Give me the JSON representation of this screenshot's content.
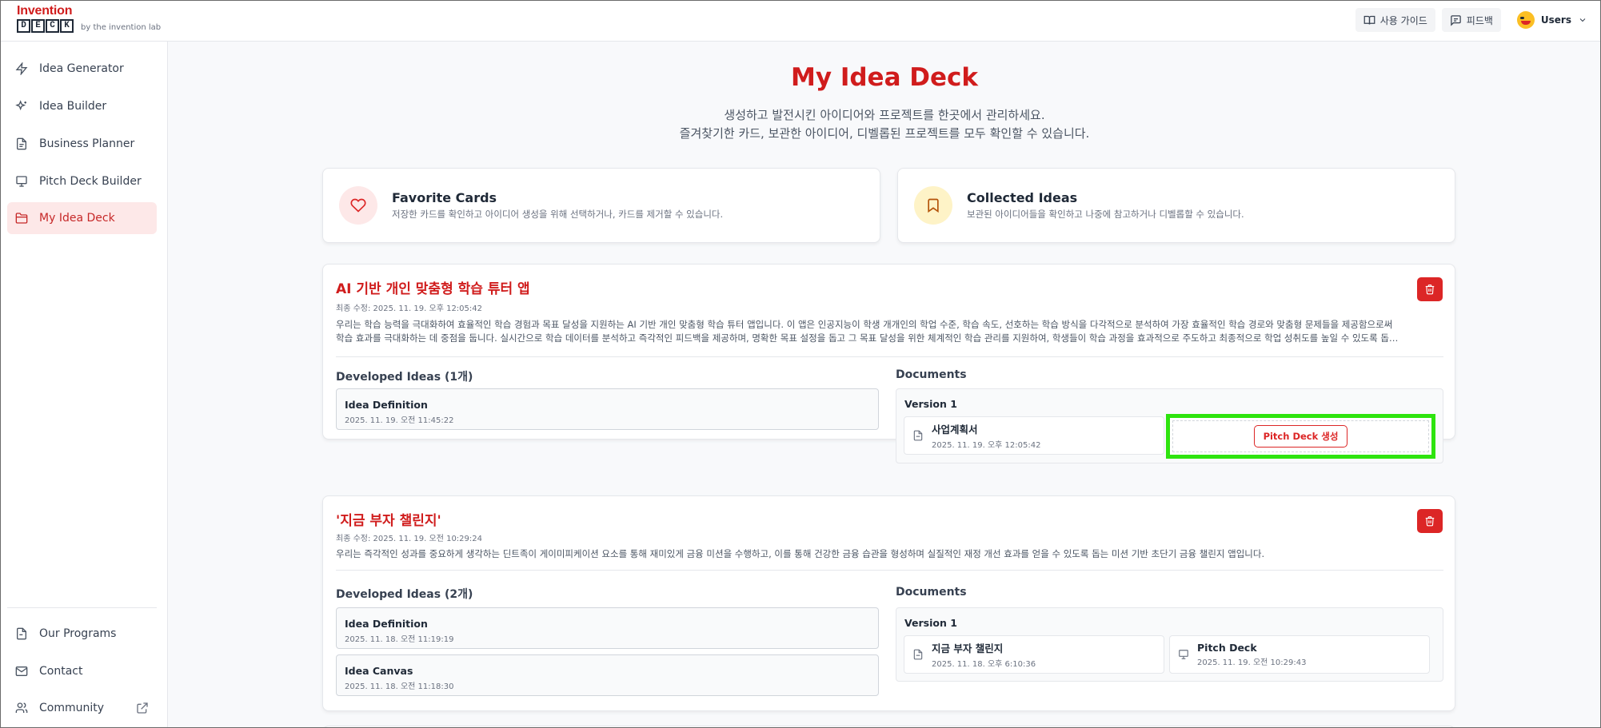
{
  "app": {
    "logo_top": "Invention",
    "logo_letters": [
      "D",
      "E",
      "C",
      "K"
    ],
    "logo_by": "by the invention lab",
    "brand_color": "#d01c1c"
  },
  "topbar": {
    "guide_label": "사용 가이드",
    "guide_icon": "book-open-icon",
    "feedback_label": "피드백",
    "feedback_icon": "message-square-icon",
    "user_label": "Users"
  },
  "sidebar": {
    "items": [
      {
        "label": "Idea Generator",
        "icon": "zap-icon"
      },
      {
        "label": "Idea Builder",
        "icon": "sparkles-icon"
      },
      {
        "label": "Business Planner",
        "icon": "file-text-icon"
      },
      {
        "label": "Pitch Deck Builder",
        "icon": "presentation-icon"
      },
      {
        "label": "My Idea Deck",
        "icon": "folder-icon",
        "active": true
      }
    ],
    "bottom_items": [
      {
        "label": "Our Programs",
        "icon": "file-icon"
      },
      {
        "label": "Contact",
        "icon": "mail-icon"
      },
      {
        "label": "Community",
        "icon": "users-icon",
        "external": true
      }
    ]
  },
  "page": {
    "title": "My Idea Deck",
    "subtitle_line1": "생성하고 발전시킨 아이디어와 프로젝트를 한곳에서 관리하세요.",
    "subtitle_line2": "즐겨찾기한 카드, 보관한 아이디어, 디벨롭된 프로젝트를 모두 확인할 수 있습니다."
  },
  "summary": {
    "favorites": {
      "title": "Favorite Cards",
      "desc": "저장한 카드를 확인하고 아이디어 생성을 위해 선택하거나, 카드를 제거할 수 있습니다.",
      "icon": "heart-icon"
    },
    "collected": {
      "title": "Collected Ideas",
      "desc": "보관된 아이디어들을 확인하고 나중에 참고하거나 디벨롭할 수 있습니다.",
      "icon": "bookmark-icon"
    }
  },
  "projects": [
    {
      "title": "AI 기반 개인 맞춤형 학습 튜터 앱",
      "modified": "최종 수정: 2025. 11. 19. 오후 12:05:42",
      "desc_line1": "우리는 학습 능력을 극대화하여 효율적인 학습 경험과 목표 달성을 지원하는 AI 기반 개인 맞춤형 학습 튜터 앱입니다. 이 앱은 인공지능이 학생 개개인의 학업 수준, 학습 속도, 선호하는 학습 방식을 다각적으로 분석하여 가장 효율적인 학습 경로와 맞춤형 문제들을 제공함으로써",
      "desc_line2": "학습 효과를 극대화하는 데 중점을 둡니다. 실시간으로 학습 데이터를 분석하고 즉각적인 피드백을 제공하며, 명확한 목표 설정을 돕고 그 목표 달성을 위한 체계적인 학습 관리를 지원하여, 학생들이 학습 과정을 효과적으로 주도하고 최종적으로 학업 성취도를 높일 수 있도록 돕…",
      "developed_label": "Developed Ideas (1개)",
      "ideas": [
        {
          "name": "Idea Definition",
          "date": "2025. 11. 19. 오전 11:45:22"
        }
      ],
      "documents_label": "Documents",
      "version_label": "Version 1",
      "docs": [
        {
          "name": "사업계획서",
          "date": "2025. 11. 19. 오후 12:05:42",
          "icon": "file-text-icon"
        }
      ],
      "pitch_button": "Pitch Deck 생성"
    },
    {
      "title": "'지금 부자 챌린지'",
      "modified": "최종 수정: 2025. 11. 19. 오전 10:29:24",
      "desc_line1": "우리는 즉각적인 성과를 중요하게 생각하는 딘트족이 게이미피케이션 요소를 통해 재미있게 금융 미션을 수행하고, 이를 통해 건강한 금융 습관을 형성하며 실질적인 재정 개선 효과를 얻을 수 있도록 돕는 미션 기반 초단기 금융 챌린지 앱입니다.",
      "developed_label": "Developed Ideas (2개)",
      "ideas": [
        {
          "name": "Idea Definition",
          "date": "2025. 11. 18. 오전 11:19:19"
        },
        {
          "name": "Idea Canvas",
          "date": "2025. 11. 18. 오전 11:18:30"
        }
      ],
      "documents_label": "Documents",
      "version_label": "Version 1",
      "docs": [
        {
          "name": "지금 부자 챌린지",
          "date": "2025. 11. 18. 오후 6:10:36",
          "icon": "file-text-icon"
        },
        {
          "name": "Pitch Deck",
          "date": "2025. 11. 19. 오전 10:29:43",
          "icon": "presentation-icon"
        }
      ]
    }
  ]
}
